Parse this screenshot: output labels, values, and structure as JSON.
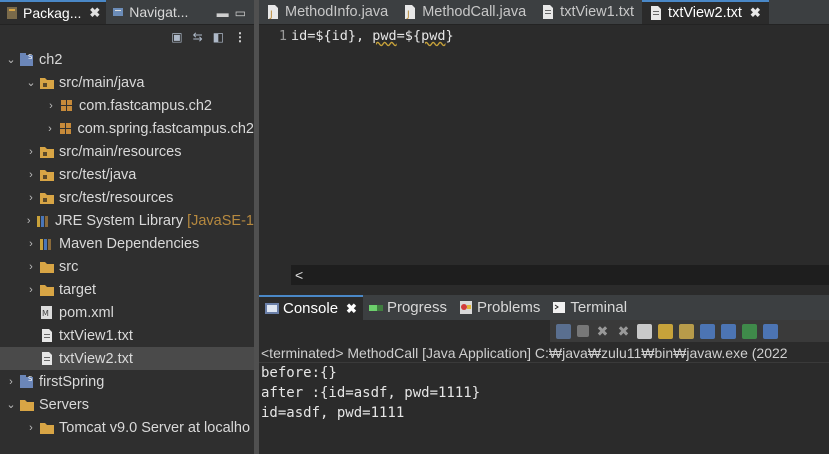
{
  "left_panel": {
    "tabs": [
      {
        "label": "Packag...",
        "active": true
      },
      {
        "label": "Navigat...",
        "active": false
      }
    ],
    "tree": [
      {
        "label": "ch2",
        "depth": 0,
        "chevron": "open",
        "icon": "project-icon"
      },
      {
        "label": "src/main/java",
        "depth": 1,
        "chevron": "open",
        "icon": "source-folder-icon"
      },
      {
        "label": "com.fastcampus.ch2",
        "depth": 2,
        "chevron": "closed",
        "icon": "package-icon"
      },
      {
        "label": "com.spring.fastcampus.ch2",
        "depth": 2,
        "chevron": "closed",
        "icon": "package-icon"
      },
      {
        "label": "src/main/resources",
        "depth": 1,
        "chevron": "closed",
        "icon": "source-folder-icon"
      },
      {
        "label": "src/test/java",
        "depth": 1,
        "chevron": "closed",
        "icon": "source-folder-icon"
      },
      {
        "label": "src/test/resources",
        "depth": 1,
        "chevron": "closed",
        "icon": "source-folder-icon"
      },
      {
        "label": "JRE System Library",
        "suffix": "[JavaSE-1",
        "depth": 1,
        "chevron": "closed",
        "icon": "library-icon"
      },
      {
        "label": "Maven Dependencies",
        "depth": 1,
        "chevron": "closed",
        "icon": "library-icon"
      },
      {
        "label": "src",
        "depth": 1,
        "chevron": "closed",
        "icon": "folder-icon"
      },
      {
        "label": "target",
        "depth": 1,
        "chevron": "closed",
        "icon": "folder-icon"
      },
      {
        "label": "pom.xml",
        "depth": 1,
        "chevron": "none",
        "icon": "xml-file-icon"
      },
      {
        "label": "txtView1.txt",
        "depth": 1,
        "chevron": "none",
        "icon": "text-file-icon"
      },
      {
        "label": "txtView2.txt",
        "depth": 1,
        "chevron": "none",
        "icon": "text-file-icon",
        "selected": true
      },
      {
        "label": "firstSpring",
        "depth": 0,
        "chevron": "closed",
        "icon": "project-icon"
      },
      {
        "label": "Servers",
        "depth": 0,
        "chevron": "open",
        "icon": "folder-icon"
      },
      {
        "label": "Tomcat v9.0 Server at localho",
        "depth": 1,
        "chevron": "closed",
        "icon": "folder-icon"
      }
    ]
  },
  "editor": {
    "tabs": [
      {
        "label": "MethodInfo.java",
        "icon": "java-file-icon",
        "active": false
      },
      {
        "label": "MethodCall.java",
        "icon": "java-file-icon",
        "active": false
      },
      {
        "label": "txtView1.txt",
        "icon": "text-file-icon",
        "active": false
      },
      {
        "label": "txtView2.txt",
        "icon": "text-file-icon",
        "active": true,
        "close": "✖"
      }
    ],
    "line_number": "1",
    "code_prefix": "id=${id}, ",
    "code_squiggle1": "pwd",
    "code_mid": "=${",
    "code_squiggle2": "pwd",
    "code_suffix": "}",
    "scroll_left": "<"
  },
  "console": {
    "tabs": [
      {
        "label": "Console",
        "icon": "console-icon",
        "active": true
      },
      {
        "label": "Progress",
        "icon": "progress-icon",
        "active": false
      },
      {
        "label": "Problems",
        "icon": "problems-icon",
        "active": false
      },
      {
        "label": "Terminal",
        "icon": "terminal-icon",
        "active": false
      }
    ],
    "status": "<terminated> MethodCall [Java Application] C:₩java₩zulu11₩bin₩javaw.exe  (2022",
    "output": [
      "before:{}",
      "after :{id=asdf, pwd=1111}",
      "id=asdf, pwd=1111"
    ]
  },
  "colors": {
    "accent": "#4a88c7",
    "background": "#2b2b2b",
    "folder": "#d8a545",
    "package": "#c68a3a"
  }
}
